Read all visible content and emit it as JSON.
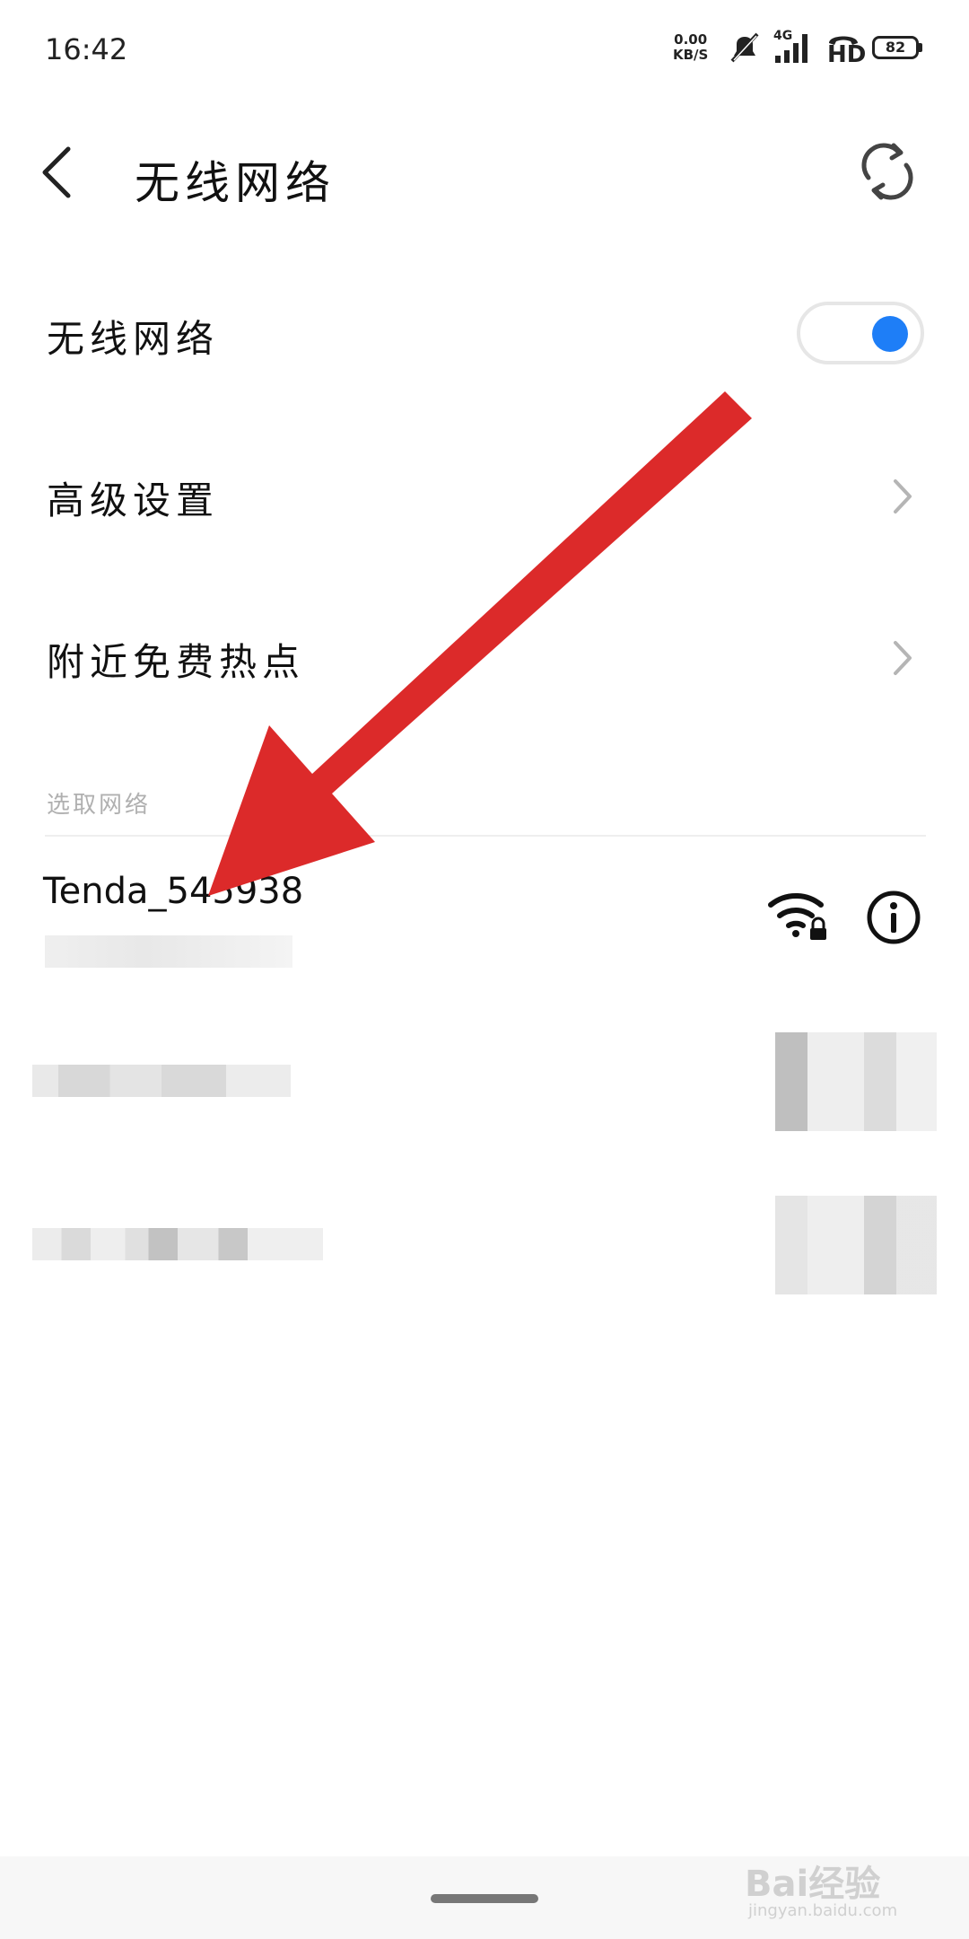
{
  "status_bar": {
    "time": "16:42",
    "net_speed_value": "0.00",
    "net_speed_unit": "KB/S",
    "signal_label": "4G",
    "hd_label": "HD",
    "battery_level": "82"
  },
  "header": {
    "title": "无线网络"
  },
  "settings": {
    "wifi_label": "无线网络",
    "wifi_enabled": true,
    "advanced_label": "高级设置",
    "hotspots_label": "附近免费热点"
  },
  "networks": {
    "section_label": "选取网络",
    "items": [
      {
        "name": "Tenda_545938",
        "secured": true
      }
    ]
  },
  "watermark": {
    "brand": "Bai经验",
    "url": "jingyan.baidu.com"
  },
  "colors": {
    "accent": "#1e7ef7",
    "annotation_arrow": "#dc2a2a"
  }
}
